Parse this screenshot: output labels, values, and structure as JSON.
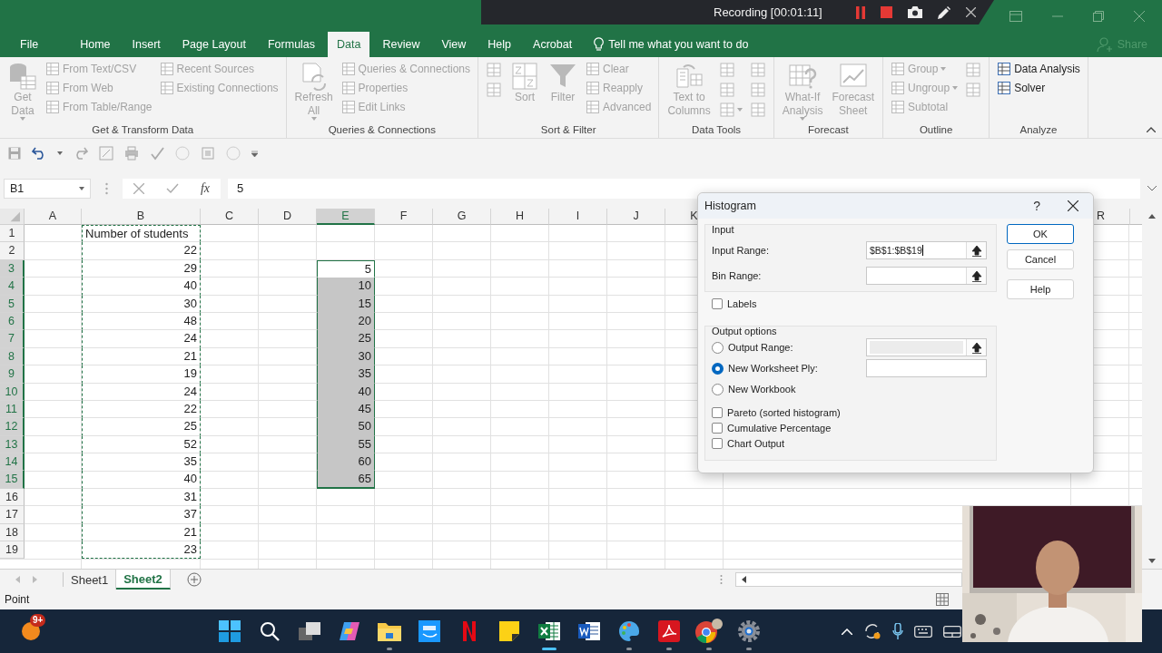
{
  "recorder": {
    "status": "Recording [00:01:11]"
  },
  "tabs": [
    {
      "label": "File",
      "selected": false
    },
    {
      "label": "Home",
      "selected": false
    },
    {
      "label": "Insert",
      "selected": false
    },
    {
      "label": "Page Layout",
      "selected": false
    },
    {
      "label": "Formulas",
      "selected": false
    },
    {
      "label": "Data",
      "selected": true
    },
    {
      "label": "Review",
      "selected": false
    },
    {
      "label": "View",
      "selected": false
    },
    {
      "label": "Help",
      "selected": false
    },
    {
      "label": "Acrobat",
      "selected": false
    }
  ],
  "tell_me": "Tell me what you want to do",
  "share": {
    "label": "Share",
    "disabled": true
  },
  "ribbon": {
    "groups": [
      {
        "label": "Get & Transform Data",
        "columns": [
          [
            {
              "kind": "large",
              "lines": [
                "Get",
                "Data"
              ],
              "dropdown": true,
              "disabled": true
            }
          ],
          [
            {
              "kind": "small",
              "label": "From Text/CSV",
              "disabled": true
            },
            {
              "kind": "small",
              "label": "From Web",
              "disabled": true
            },
            {
              "kind": "small",
              "label": "From Table/Range",
              "disabled": true
            }
          ],
          [
            {
              "kind": "small",
              "label": "Recent Sources",
              "disabled": true
            },
            {
              "kind": "small",
              "label": "Existing Connections",
              "disabled": true
            }
          ]
        ]
      },
      {
        "columns": [
          [
            {
              "kind": "large",
              "lines": [
                "Refresh",
                "All"
              ],
              "dropdown": true,
              "disabled": true
            }
          ],
          [
            {
              "kind": "small",
              "label": "Queries & Connections",
              "disabled": true
            },
            {
              "kind": "small",
              "label": "Properties",
              "disabled": true
            },
            {
              "kind": "small",
              "label": "Edit Links",
              "disabled": true
            }
          ]
        ],
        "label": "Queries & Connections"
      },
      {
        "label": "Sort & Filter",
        "columns": [
          [
            {
              "kind": "icon",
              "disabled": true
            },
            {
              "kind": "icon",
              "disabled": true
            }
          ],
          [
            {
              "kind": "large",
              "lines": [
                "Sort"
              ],
              "disabled": true
            }
          ],
          [
            {
              "kind": "large",
              "lines": [
                "Filter"
              ],
              "disabled": true
            }
          ],
          [
            {
              "kind": "small",
              "label": "Clear",
              "disabled": true
            },
            {
              "kind": "small",
              "label": "Reapply",
              "disabled": true
            },
            {
              "kind": "small",
              "label": "Advanced",
              "disabled": true
            }
          ]
        ]
      },
      {
        "label": "Data Tools",
        "columns": [
          [
            {
              "kind": "large",
              "lines": [
                "Text to",
                "Columns"
              ],
              "disabled": true
            }
          ],
          [
            {
              "kind": "icon",
              "disabled": true
            },
            {
              "kind": "icon",
              "disabled": true
            },
            {
              "kind": "icon",
              "dropdown": true,
              "disabled": true
            }
          ],
          [
            {
              "kind": "icon",
              "disabled": true
            },
            {
              "kind": "icon",
              "disabled": true
            },
            {
              "kind": "icon",
              "disabled": true
            }
          ]
        ]
      },
      {
        "label": "Forecast",
        "columns": [
          [
            {
              "kind": "large",
              "lines": [
                "What-If",
                "Analysis"
              ],
              "dropdown": true,
              "disabled": true
            }
          ],
          [
            {
              "kind": "large",
              "lines": [
                "Forecast",
                "Sheet"
              ],
              "disabled": true
            }
          ]
        ]
      },
      {
        "label": "Outline",
        "columns": [
          [
            {
              "kind": "small",
              "label": "Group",
              "dropdown": true,
              "disabled": true
            },
            {
              "kind": "small",
              "label": "Ungroup",
              "dropdown": true,
              "disabled": true
            },
            {
              "kind": "small",
              "label": "Subtotal",
              "disabled": true
            }
          ],
          [
            {
              "kind": "icon",
              "disabled": true
            },
            {
              "kind": "icon",
              "disabled": true
            }
          ]
        ]
      },
      {
        "label": "Analyze",
        "columns": [
          [
            {
              "kind": "small",
              "label": "Data Analysis",
              "disabled": false
            },
            {
              "kind": "small",
              "label": "Solver",
              "disabled": false
            }
          ]
        ]
      }
    ]
  },
  "formula_bar": {
    "name_box": "B1",
    "fx": "fx",
    "value": "5"
  },
  "columns": [
    {
      "letter": "A",
      "selected": false,
      "copied": false
    },
    {
      "letter": "B",
      "selected": false,
      "copied": true
    },
    {
      "letter": "C",
      "selected": false,
      "copied": false
    },
    {
      "letter": "D",
      "selected": false,
      "copied": false
    },
    {
      "letter": "E",
      "selected": true,
      "copied": false
    },
    {
      "letter": "F",
      "selected": false,
      "copied": false
    },
    {
      "letter": "G",
      "selected": false,
      "copied": false
    },
    {
      "letter": "H",
      "selected": false,
      "copied": false
    },
    {
      "letter": "I",
      "selected": false,
      "copied": false
    },
    {
      "letter": "J",
      "selected": false,
      "copied": false
    },
    {
      "letter": "K",
      "selected": false,
      "copied": false
    }
  ],
  "far_columns": [
    {
      "letter": "R",
      "selected": false
    }
  ],
  "rows": [
    {
      "number": "1",
      "kind": "text",
      "selected": false,
      "cells": {
        "B": "Number of students"
      }
    },
    {
      "number": "2",
      "kind": "number",
      "selected": false,
      "cells": {
        "B": "22"
      }
    },
    {
      "number": "3",
      "kind": "number",
      "selected": true,
      "cells": {
        "B": "29",
        "E": {
          "value": "5",
          "highlighted": false
        }
      }
    },
    {
      "number": "4",
      "kind": "number",
      "selected": true,
      "cells": {
        "B": "40",
        "E": {
          "value": "10",
          "highlighted": true
        }
      }
    },
    {
      "number": "5",
      "kind": "number",
      "selected": true,
      "cells": {
        "B": "30",
        "E": {
          "value": "15",
          "highlighted": true
        }
      }
    },
    {
      "number": "6",
      "kind": "number",
      "selected": true,
      "cells": {
        "B": "48",
        "E": {
          "value": "20",
          "highlighted": true
        }
      }
    },
    {
      "number": "7",
      "kind": "number",
      "selected": true,
      "cells": {
        "B": "24",
        "E": {
          "value": "25",
          "highlighted": true
        }
      }
    },
    {
      "number": "8",
      "kind": "number",
      "selected": true,
      "cells": {
        "B": "21",
        "E": {
          "value": "30",
          "highlighted": true
        }
      }
    },
    {
      "number": "9",
      "kind": "number",
      "selected": true,
      "cells": {
        "B": "19",
        "E": {
          "value": "35",
          "highlighted": true
        }
      }
    },
    {
      "number": "10",
      "kind": "number",
      "selected": true,
      "cells": {
        "B": "24",
        "E": {
          "value": "40",
          "highlighted": true
        }
      }
    },
    {
      "number": "11",
      "kind": "number",
      "selected": true,
      "cells": {
        "B": "22",
        "E": {
          "value": "45",
          "highlighted": true
        }
      }
    },
    {
      "number": "12",
      "kind": "number",
      "selected": true,
      "cells": {
        "B": "25",
        "E": {
          "value": "50",
          "highlighted": true
        }
      }
    },
    {
      "number": "13",
      "kind": "number",
      "selected": true,
      "cells": {
        "B": "52",
        "E": {
          "value": "55",
          "highlighted": true
        }
      }
    },
    {
      "number": "14",
      "kind": "number",
      "selected": true,
      "cells": {
        "B": "35",
        "E": {
          "value": "60",
          "highlighted": true
        }
      }
    },
    {
      "number": "15",
      "kind": "number",
      "selected": true,
      "cells": {
        "B": "40",
        "E": {
          "value": "65",
          "highlighted": true
        }
      }
    },
    {
      "number": "16",
      "kind": "number",
      "selected": false,
      "cells": {
        "B": "31"
      }
    },
    {
      "number": "17",
      "kind": "number",
      "selected": false,
      "cells": {
        "B": "37"
      }
    },
    {
      "number": "18",
      "kind": "number",
      "selected": false,
      "cells": {
        "B": "21"
      }
    },
    {
      "number": "19",
      "kind": "number",
      "selected": false,
      "cells": {
        "B": "23"
      }
    }
  ],
  "sheet_tabs": [
    {
      "label": "Sheet1",
      "selected": false
    },
    {
      "label": "Sheet2",
      "selected": true
    }
  ],
  "status": "Point",
  "dialog": {
    "title": "Histogram",
    "help": "?",
    "input_group": "Input",
    "fields": [
      {
        "label": "Input Range:",
        "value": "$B$1:$B$19"
      },
      {
        "label": "Bin Range:"
      }
    ],
    "labels_checkbox": {
      "label": "Labels",
      "checked": false
    },
    "output_group": "Output options",
    "outputs": [
      {
        "label": "Output Range:",
        "selected": false,
        "field": {
          "kind": "ref",
          "disabled": true
        }
      },
      {
        "label": "New Worksheet Ply:",
        "selected": true,
        "field": {
          "kind": "plain",
          "disabled": false
        }
      },
      {
        "label": "New Workbook",
        "selected": false
      }
    ],
    "checkboxes": [
      {
        "label": "Pareto (sorted histogram)",
        "checked": false
      },
      {
        "label": "Cumulative Percentage",
        "checked": false
      },
      {
        "label": "Chart Output",
        "checked": false
      }
    ],
    "buttons": [
      {
        "label": "OK",
        "default": true
      },
      {
        "label": "Cancel",
        "default": false
      },
      {
        "label": "Help",
        "default": false
      }
    ]
  },
  "taskbar": {
    "badge": "9+",
    "apps": [
      {
        "kind": "start",
        "running": false,
        "selected": false
      },
      {
        "kind": "search",
        "running": false,
        "selected": false
      },
      {
        "kind": "taskview",
        "running": false,
        "selected": false
      },
      {
        "kind": "copilot",
        "running": false,
        "selected": false
      },
      {
        "kind": "explorer",
        "running": true,
        "selected": false
      },
      {
        "kind": "video",
        "running": false,
        "selected": false
      },
      {
        "kind": "netflix",
        "running": false,
        "selected": false
      },
      {
        "kind": "notes",
        "running": false,
        "selected": false
      },
      {
        "kind": "excel",
        "running": true,
        "selected": true
      },
      {
        "kind": "word",
        "running": false,
        "selected": false
      },
      {
        "kind": "paint",
        "running": true,
        "selected": false
      },
      {
        "kind": "acrobat",
        "running": true,
        "selected": false
      },
      {
        "kind": "chrome",
        "running": true,
        "selected": false
      },
      {
        "kind": "settings",
        "running": true,
        "selected": false
      }
    ]
  }
}
